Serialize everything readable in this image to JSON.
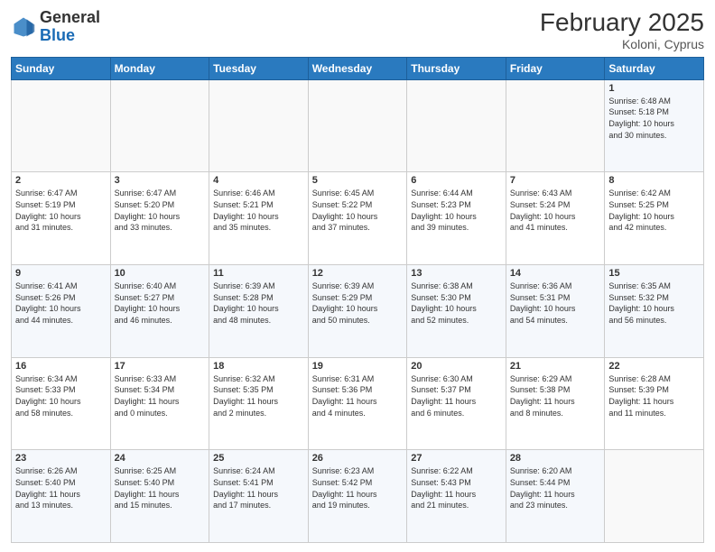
{
  "header": {
    "logo_general": "General",
    "logo_blue": "Blue",
    "month_title": "February 2025",
    "location": "Koloni, Cyprus"
  },
  "days_of_week": [
    "Sunday",
    "Monday",
    "Tuesday",
    "Wednesday",
    "Thursday",
    "Friday",
    "Saturday"
  ],
  "weeks": [
    [
      {
        "num": "",
        "info": ""
      },
      {
        "num": "",
        "info": ""
      },
      {
        "num": "",
        "info": ""
      },
      {
        "num": "",
        "info": ""
      },
      {
        "num": "",
        "info": ""
      },
      {
        "num": "",
        "info": ""
      },
      {
        "num": "1",
        "info": "Sunrise: 6:48 AM\nSunset: 5:18 PM\nDaylight: 10 hours\nand 30 minutes."
      }
    ],
    [
      {
        "num": "2",
        "info": "Sunrise: 6:47 AM\nSunset: 5:19 PM\nDaylight: 10 hours\nand 31 minutes."
      },
      {
        "num": "3",
        "info": "Sunrise: 6:47 AM\nSunset: 5:20 PM\nDaylight: 10 hours\nand 33 minutes."
      },
      {
        "num": "4",
        "info": "Sunrise: 6:46 AM\nSunset: 5:21 PM\nDaylight: 10 hours\nand 35 minutes."
      },
      {
        "num": "5",
        "info": "Sunrise: 6:45 AM\nSunset: 5:22 PM\nDaylight: 10 hours\nand 37 minutes."
      },
      {
        "num": "6",
        "info": "Sunrise: 6:44 AM\nSunset: 5:23 PM\nDaylight: 10 hours\nand 39 minutes."
      },
      {
        "num": "7",
        "info": "Sunrise: 6:43 AM\nSunset: 5:24 PM\nDaylight: 10 hours\nand 41 minutes."
      },
      {
        "num": "8",
        "info": "Sunrise: 6:42 AM\nSunset: 5:25 PM\nDaylight: 10 hours\nand 42 minutes."
      }
    ],
    [
      {
        "num": "9",
        "info": "Sunrise: 6:41 AM\nSunset: 5:26 PM\nDaylight: 10 hours\nand 44 minutes."
      },
      {
        "num": "10",
        "info": "Sunrise: 6:40 AM\nSunset: 5:27 PM\nDaylight: 10 hours\nand 46 minutes."
      },
      {
        "num": "11",
        "info": "Sunrise: 6:39 AM\nSunset: 5:28 PM\nDaylight: 10 hours\nand 48 minutes."
      },
      {
        "num": "12",
        "info": "Sunrise: 6:39 AM\nSunset: 5:29 PM\nDaylight: 10 hours\nand 50 minutes."
      },
      {
        "num": "13",
        "info": "Sunrise: 6:38 AM\nSunset: 5:30 PM\nDaylight: 10 hours\nand 52 minutes."
      },
      {
        "num": "14",
        "info": "Sunrise: 6:36 AM\nSunset: 5:31 PM\nDaylight: 10 hours\nand 54 minutes."
      },
      {
        "num": "15",
        "info": "Sunrise: 6:35 AM\nSunset: 5:32 PM\nDaylight: 10 hours\nand 56 minutes."
      }
    ],
    [
      {
        "num": "16",
        "info": "Sunrise: 6:34 AM\nSunset: 5:33 PM\nDaylight: 10 hours\nand 58 minutes."
      },
      {
        "num": "17",
        "info": "Sunrise: 6:33 AM\nSunset: 5:34 PM\nDaylight: 11 hours\nand 0 minutes."
      },
      {
        "num": "18",
        "info": "Sunrise: 6:32 AM\nSunset: 5:35 PM\nDaylight: 11 hours\nand 2 minutes."
      },
      {
        "num": "19",
        "info": "Sunrise: 6:31 AM\nSunset: 5:36 PM\nDaylight: 11 hours\nand 4 minutes."
      },
      {
        "num": "20",
        "info": "Sunrise: 6:30 AM\nSunset: 5:37 PM\nDaylight: 11 hours\nand 6 minutes."
      },
      {
        "num": "21",
        "info": "Sunrise: 6:29 AM\nSunset: 5:38 PM\nDaylight: 11 hours\nand 8 minutes."
      },
      {
        "num": "22",
        "info": "Sunrise: 6:28 AM\nSunset: 5:39 PM\nDaylight: 11 hours\nand 11 minutes."
      }
    ],
    [
      {
        "num": "23",
        "info": "Sunrise: 6:26 AM\nSunset: 5:40 PM\nDaylight: 11 hours\nand 13 minutes."
      },
      {
        "num": "24",
        "info": "Sunrise: 6:25 AM\nSunset: 5:40 PM\nDaylight: 11 hours\nand 15 minutes."
      },
      {
        "num": "25",
        "info": "Sunrise: 6:24 AM\nSunset: 5:41 PM\nDaylight: 11 hours\nand 17 minutes."
      },
      {
        "num": "26",
        "info": "Sunrise: 6:23 AM\nSunset: 5:42 PM\nDaylight: 11 hours\nand 19 minutes."
      },
      {
        "num": "27",
        "info": "Sunrise: 6:22 AM\nSunset: 5:43 PM\nDaylight: 11 hours\nand 21 minutes."
      },
      {
        "num": "28",
        "info": "Sunrise: 6:20 AM\nSunset: 5:44 PM\nDaylight: 11 hours\nand 23 minutes."
      },
      {
        "num": "",
        "info": ""
      }
    ]
  ]
}
